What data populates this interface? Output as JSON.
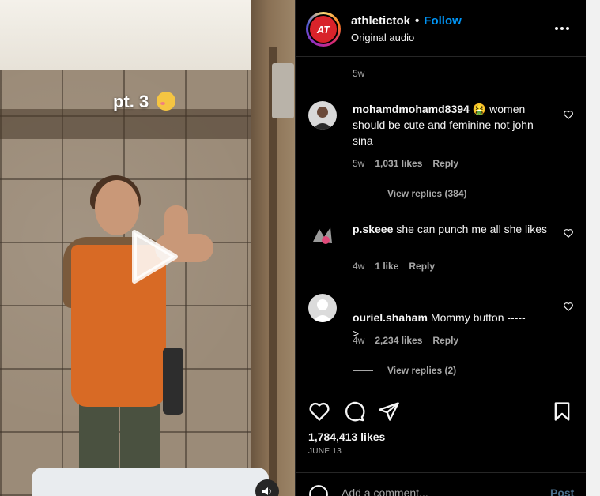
{
  "video": {
    "overlay_text": "pt. 3"
  },
  "header": {
    "username": "athletictok",
    "separator": "•",
    "follow_label": "Follow",
    "audio": "Original audio",
    "avatar_text": "AT"
  },
  "comments": {
    "top_timestamp": "5w",
    "items": [
      {
        "username": "mohamdmohamd8394",
        "text": "🤮 women should be cute and feminine not john sina",
        "time": "5w",
        "likes": "1,031 likes",
        "reply": "Reply",
        "view_replies": "View replies (384)"
      },
      {
        "username": "p.skeee",
        "text": "she can punch me all she likes",
        "time": "4w",
        "likes": "1 like",
        "reply": "Reply"
      },
      {
        "username": "ouriel.shaham",
        "text": "Mommy button -----\n>",
        "time": "4w",
        "likes": "2,234 likes",
        "reply": "Reply",
        "view_replies": "View replies (2)"
      }
    ]
  },
  "actions": {
    "likes": "1,784,413 likes",
    "date": "JUNE 13",
    "icons": [
      "heart-icon",
      "comment-icon",
      "share-icon",
      "bookmark-icon"
    ]
  },
  "add_comment": {
    "placeholder": "Add a comment...",
    "post_label": "Post"
  },
  "colors": {
    "follow": "#0095f6",
    "background": "#000000",
    "muted": "#a8a8a8"
  }
}
